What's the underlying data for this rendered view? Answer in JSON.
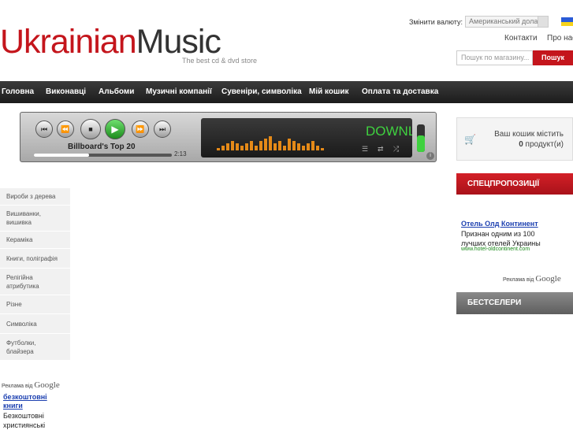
{
  "header": {
    "logo_part1": "Ukrainian",
    "logo_part2": "Music",
    "tagline": "The best cd & dvd store",
    "currency_label": "Змінити валюту:",
    "currency_value": "Американський долар",
    "links": {
      "contacts": "Контакти",
      "about": "Про нас"
    },
    "search_placeholder": "Пошук по магазину...",
    "search_button": "Пошук"
  },
  "nav": [
    "Головна",
    "Виконавці",
    "Альбоми",
    "Музичні компанії",
    "Сувеніри, символіка",
    "Мій кошик",
    "Оплата та доставка"
  ],
  "player": {
    "track_title": "Billboard's Top 20",
    "time": "2:13",
    "screen_text": "DOWNLOAD",
    "progress_fraction": 0.4,
    "volume_fraction": 0.6
  },
  "cart": {
    "line1": "Ваш кошик містить",
    "count": "0",
    "unit": "продукт(и)"
  },
  "right": {
    "special_header": "СПЕЦПРОПОЗИЦІЇ",
    "ad_link": "Отель Олд Континент",
    "ad_text": "Признан одним из 100 лучших отелей Украины",
    "ad_url": "www.hotel-oldcontinent.com",
    "ads_by": "Реклама від",
    "google": "Google",
    "best_header": "БЕСТСЕЛЕРИ"
  },
  "sidebar": {
    "items": [
      "Вироби з дерева",
      "Вишиванки, вишивка",
      "Кераміка",
      "Книги, поліграфія",
      "Релігійна атрибутика",
      "Різне",
      "Символіка",
      "Футболки, блайзера"
    ]
  },
  "left_ad": {
    "ads_by": "Реклама від",
    "google": "Google",
    "link": "безкоштовні книги",
    "text": "Безкоштовні християнські"
  },
  "colors": {
    "brand_red": "#c4151c",
    "player_green": "#3fd13f",
    "link_blue": "#1b3fb0"
  }
}
